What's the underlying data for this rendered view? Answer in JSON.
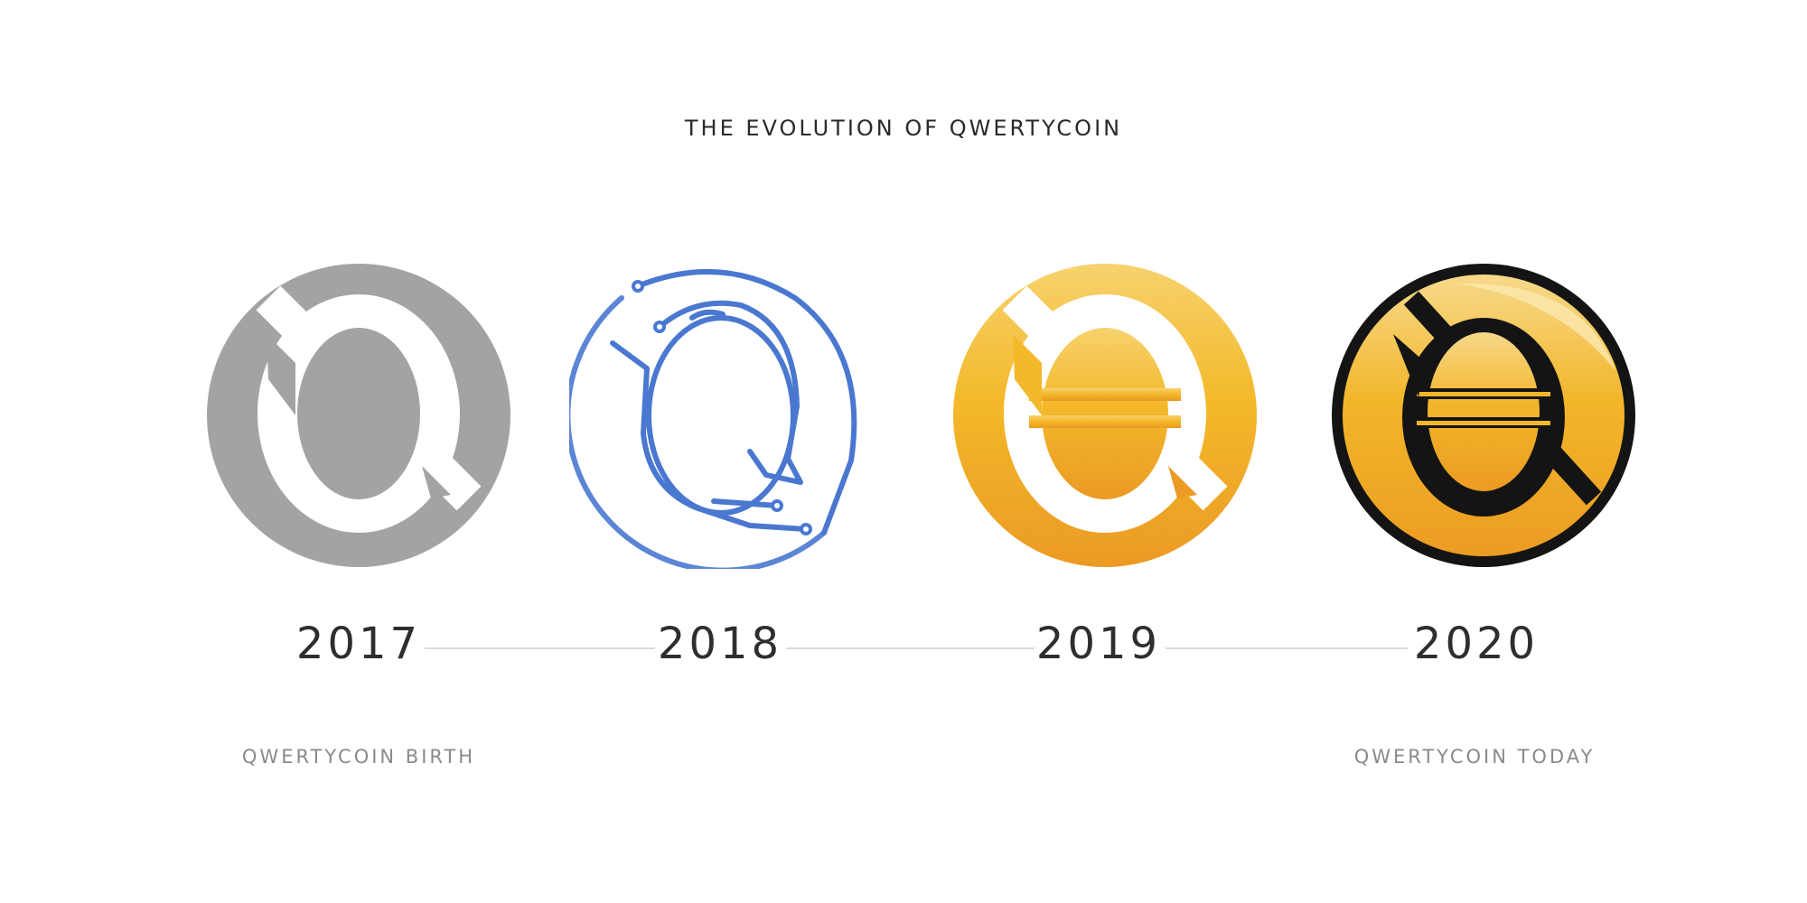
{
  "title": "THE EVOLUTION OF QWERTYCOIN",
  "timeline": [
    {
      "year": "2017",
      "logo": "qwertycoin-logo-2017-gray"
    },
    {
      "year": "2018",
      "logo": "qwertycoin-logo-2018-circuit"
    },
    {
      "year": "2019",
      "logo": "qwertycoin-logo-2019-gold"
    },
    {
      "year": "2020",
      "logo": "qwertycoin-logo-2020-gold-black-ring"
    }
  ],
  "captions": {
    "birth": "QWERTYCOIN BIRTH",
    "today": "QWERTYCOIN TODAY"
  },
  "colors": {
    "gray": "#a3a3a3",
    "circuit_blue": "#4a78d0",
    "gold_light": "#f7d26e",
    "gold": "#f0b518",
    "gold_dark": "#eb9a24",
    "black": "#141414"
  }
}
